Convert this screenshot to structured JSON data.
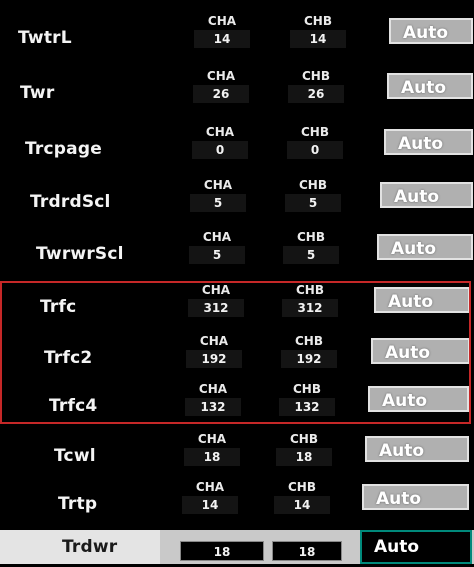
{
  "rows": [
    {
      "label": "TwtrL",
      "cha_header": "CHA",
      "chb_header": "CHB",
      "cha": "14",
      "chb": "14",
      "setting": "Auto"
    },
    {
      "label": "Twr",
      "cha_header": "CHA",
      "chb_header": "CHB",
      "cha": "26",
      "chb": "26",
      "setting": "Auto"
    },
    {
      "label": "Trcpage",
      "cha_header": "CHA",
      "chb_header": "CHB",
      "cha": "0",
      "chb": "0",
      "setting": "Auto"
    },
    {
      "label": "TrdrdScl",
      "cha_header": "CHA",
      "chb_header": "CHB",
      "cha": "5",
      "chb": "5",
      "setting": "Auto"
    },
    {
      "label": "TwrwrScl",
      "cha_header": "CHA",
      "chb_header": "CHB",
      "cha": "5",
      "chb": "5",
      "setting": "Auto"
    },
    {
      "label": "Trfc",
      "cha_header": "CHA",
      "chb_header": "CHB",
      "cha": "312",
      "chb": "312",
      "setting": "Auto"
    },
    {
      "label": "Trfc2",
      "cha_header": "CHA",
      "chb_header": "CHB",
      "cha": "192",
      "chb": "192",
      "setting": "Auto"
    },
    {
      "label": "Trfc4",
      "cha_header": "CHA",
      "chb_header": "CHB",
      "cha": "132",
      "chb": "132",
      "setting": "Auto"
    },
    {
      "label": "Tcwl",
      "cha_header": "CHA",
      "chb_header": "CHB",
      "cha": "18",
      "chb": "18",
      "setting": "Auto"
    },
    {
      "label": "Trtp",
      "cha_header": "CHA",
      "chb_header": "CHB",
      "cha": "14",
      "chb": "14",
      "setting": "Auto"
    }
  ],
  "selected_row": {
    "label": "Trdwr",
    "cha": "18",
    "chb": "18",
    "setting": "Auto"
  },
  "colors": {
    "highlight_border": "#c62828",
    "selected_auto_border": "#00897b",
    "auto_button": "#b0b0b0",
    "background": "#000000"
  }
}
